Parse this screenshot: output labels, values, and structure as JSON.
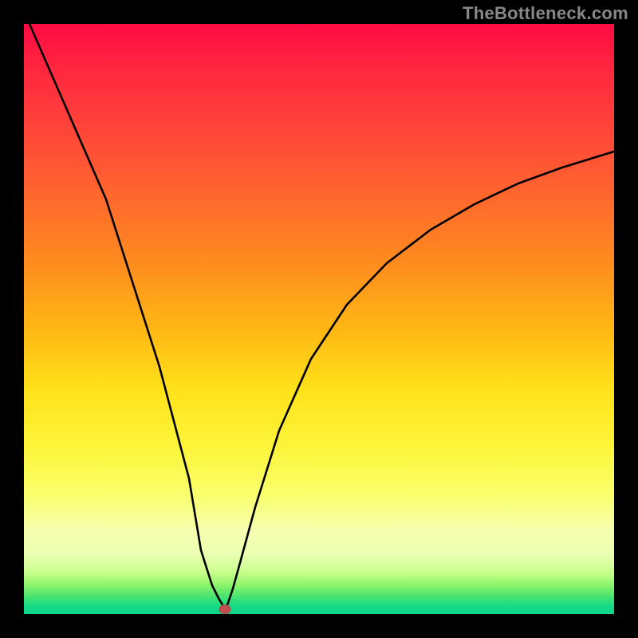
{
  "watermark": "TheBottleneck.com",
  "chart_data": {
    "type": "line",
    "title": "",
    "xlabel": "",
    "ylabel": "",
    "xlim": [
      0,
      100
    ],
    "ylim": [
      0,
      100
    ],
    "series": [
      {
        "name": "bottleneck-curve",
        "x": [
          0,
          5,
          10,
          15,
          20,
          25,
          28,
          30,
          32,
          34,
          36,
          38,
          40,
          45,
          50,
          55,
          60,
          65,
          70,
          75,
          80,
          85,
          90,
          95,
          100
        ],
        "values": [
          100,
          86,
          72,
          58,
          44,
          30,
          14,
          6,
          2,
          0,
          2,
          9,
          18,
          34,
          46,
          55,
          62,
          67,
          71,
          75,
          77,
          79,
          81,
          82,
          83
        ]
      }
    ],
    "marker": {
      "x": 34,
      "y": 0,
      "name": "optimal-point"
    },
    "gradient_stops": [
      {
        "pct": 0,
        "color": "#ff0b42"
      },
      {
        "pct": 25,
        "color": "#ff5a33"
      },
      {
        "pct": 52,
        "color": "#ffb814"
      },
      {
        "pct": 72,
        "color": "#fcf53b"
      },
      {
        "pct": 90,
        "color": "#eaffb0"
      },
      {
        "pct": 97,
        "color": "#4be470"
      },
      {
        "pct": 100,
        "color": "#0fd58d"
      }
    ]
  }
}
